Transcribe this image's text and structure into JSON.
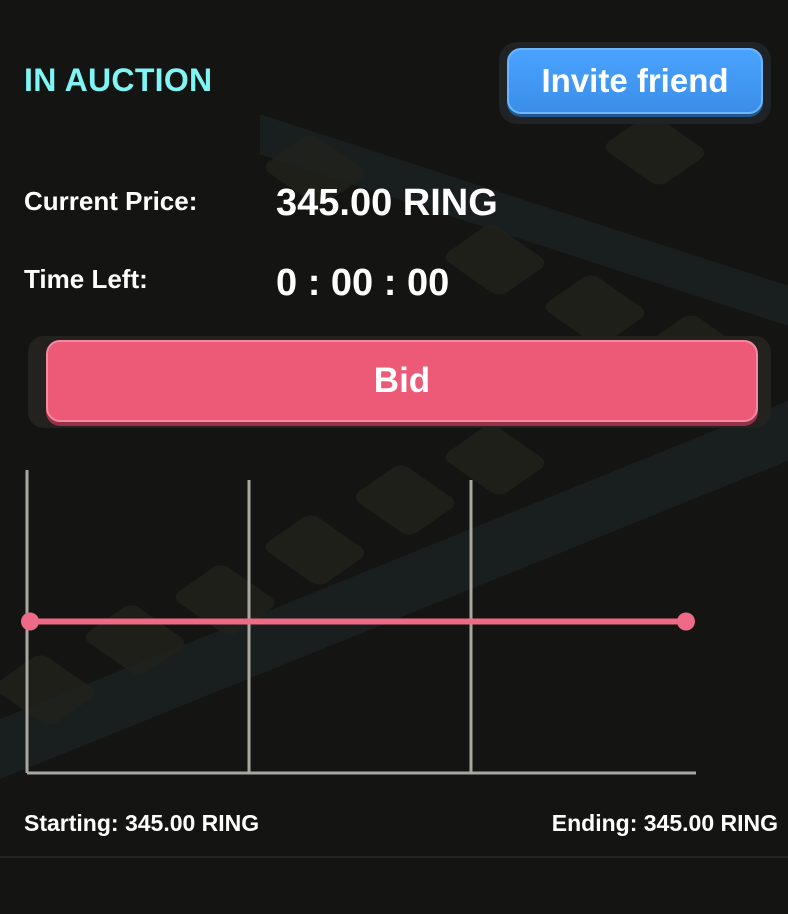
{
  "status": "IN AUCTION",
  "invite_label": "Invite friend",
  "current_price_label": "Current Price:",
  "current_price_value": "345.00 RING",
  "time_left_label": "Time Left:",
  "time_left_value": "0 : 00 : 00",
  "bid_label": "Bid",
  "starting_text": "Starting: 345.00 RING",
  "ending_text": "Ending: 345.00 RING",
  "colors": {
    "status": "#7ff5f5",
    "invite_button": "#4aa3ff",
    "bid_button": "#ec5a78",
    "price_line": "#ee6a86",
    "axis": "#a8a8a0"
  },
  "chart_data": {
    "type": "line",
    "xlabel": "",
    "ylabel": "",
    "x": [
      0,
      1
    ],
    "series": [
      {
        "values": [
          345.0,
          345.0
        ]
      }
    ],
    "ylim": [
      0,
      690
    ],
    "grid": true,
    "vertical_gridlines": 3
  }
}
